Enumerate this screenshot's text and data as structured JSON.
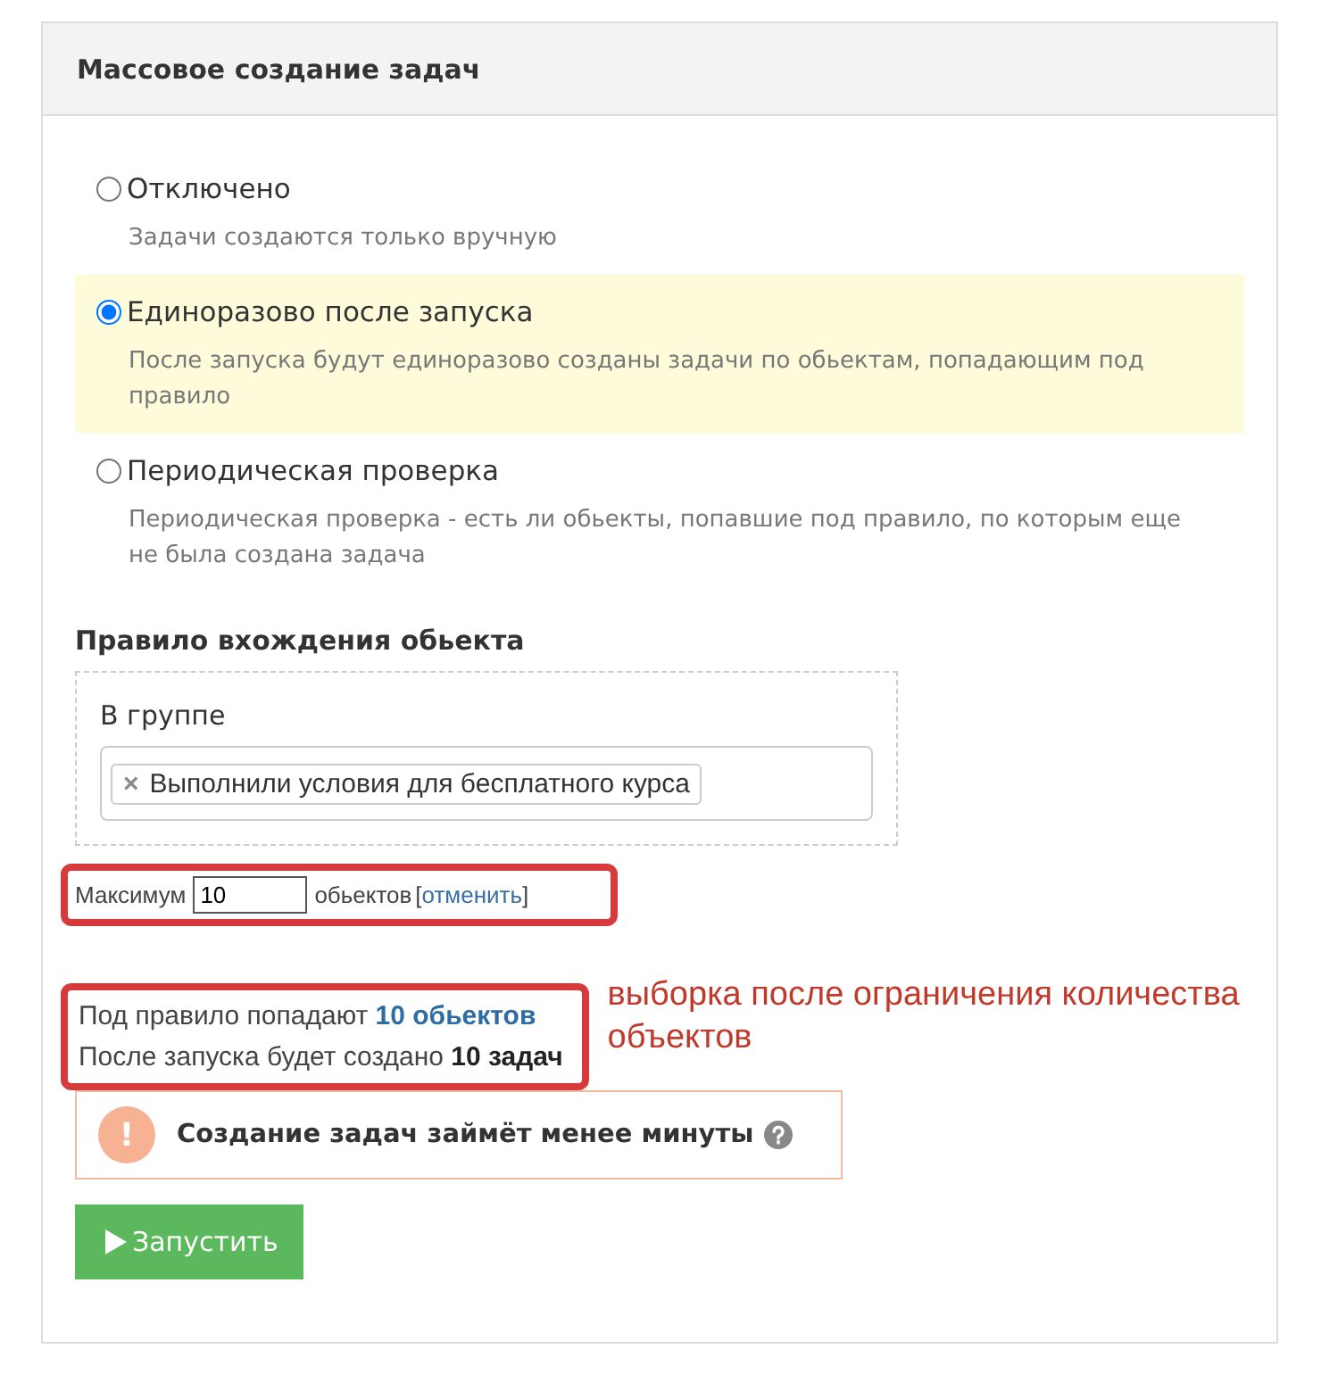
{
  "panel": {
    "title": "Массовое создание задач"
  },
  "modes": [
    {
      "label": "Отключено",
      "description": "Задачи создаются только вручную",
      "selected": false
    },
    {
      "label": "Единоразово после запуска",
      "description": "После запуска будут единоразово созданы задачи по обьектам, попадающим под правило",
      "selected": true
    },
    {
      "label": "Периодическая проверка",
      "description": "Периодическая проверка - есть ли обьекты, попавшие под правило, по которым еще не была создана задача",
      "selected": false
    }
  ],
  "rule": {
    "title": "Правило вхождения обьекта",
    "group_label": "В группе",
    "tags": [
      {
        "remove": "×",
        "label": "Выполнили условия для бесплатного курса"
      }
    ]
  },
  "limit": {
    "prefix": "Максимум",
    "value": "10",
    "suffix": "обьектов",
    "cancel_open": "[",
    "cancel": "отменить",
    "cancel_close": "]"
  },
  "summary": [
    "Под правило попадают **10 обьектов**",
    "После запуска будет создано  **10 задач**"
  ],
  "annotation": "выборка после ограничения количества объектов",
  "notice": {
    "icon": "!",
    "text": "Создание задач займёт менее минуты"
  },
  "run_button": {
    "label": "Запустить"
  }
}
